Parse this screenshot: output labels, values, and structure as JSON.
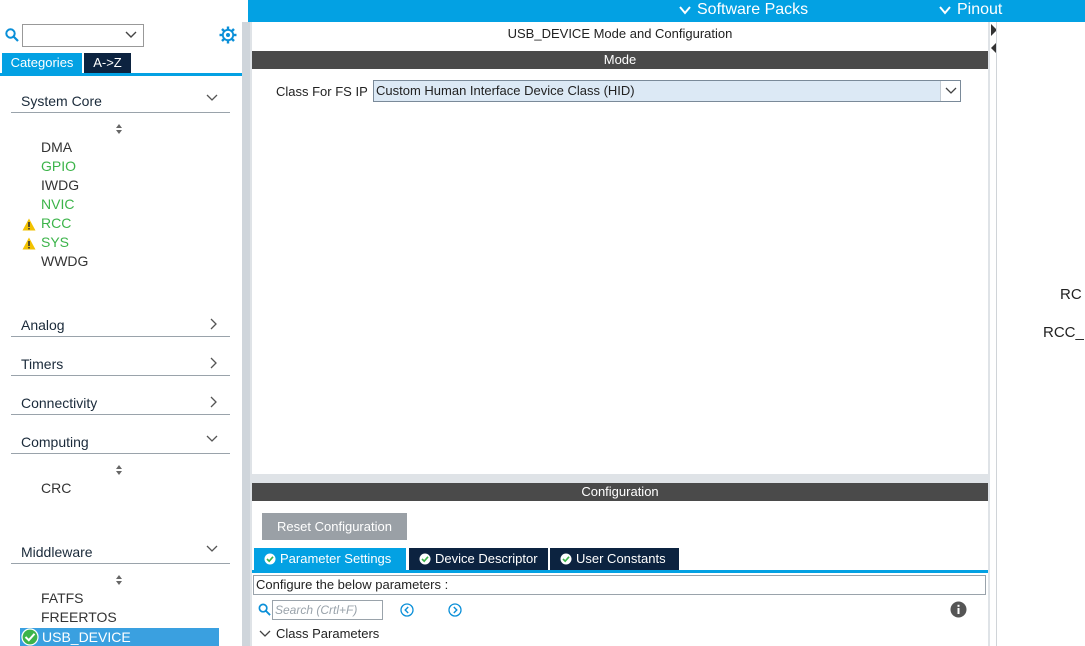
{
  "header": {
    "software_packs": "Software Packs",
    "pinout": "Pinout"
  },
  "sidebar": {
    "tabs": [
      "Categories",
      "A->Z"
    ],
    "sections": {
      "system_core": {
        "label": "System Core",
        "items": [
          {
            "label": "DMA",
            "color": "#333333",
            "warning": false
          },
          {
            "label": "GPIO",
            "color": "#3cb44a",
            "warning": false
          },
          {
            "label": "IWDG",
            "color": "#333333",
            "warning": false
          },
          {
            "label": "NVIC",
            "color": "#3cb44a",
            "warning": false
          },
          {
            "label": "RCC",
            "color": "#3cb44a",
            "warning": true
          },
          {
            "label": "SYS",
            "color": "#3cb44a",
            "warning": true
          },
          {
            "label": "WWDG",
            "color": "#333333",
            "warning": false
          }
        ]
      },
      "analog": {
        "label": "Analog"
      },
      "timers": {
        "label": "Timers"
      },
      "connectivity": {
        "label": "Connectivity"
      },
      "computing": {
        "label": "Computing",
        "items": [
          {
            "label": "CRC"
          }
        ]
      },
      "middleware": {
        "label": "Middleware",
        "items": [
          {
            "label": "FATFS"
          },
          {
            "label": "FREERTOS"
          },
          {
            "label": "USB_DEVICE",
            "selected": true
          }
        ]
      }
    }
  },
  "main": {
    "title": "USB_DEVICE Mode and Configuration",
    "mode_header": "Mode",
    "class_label": "Class For FS IP",
    "class_value": "Custom Human Interface Device Class (HID)",
    "config_header": "Configuration",
    "reset_button": "Reset Configuration",
    "tabs": [
      "Parameter Settings",
      "Device Descriptor",
      "User Constants"
    ],
    "active_tab": "Parameter Settings",
    "description": "Configure the below parameters :",
    "search_placeholder": "Search (Crtl+F)",
    "class_parameters": "Class Parameters"
  },
  "pinout_view": {
    "labels": [
      "RC",
      "RCC_"
    ]
  },
  "colors": {
    "accent": "#03a1e3",
    "dark_tab": "#0c2340",
    "ok_green": "#3cb44a",
    "warning": "#f2c200"
  }
}
